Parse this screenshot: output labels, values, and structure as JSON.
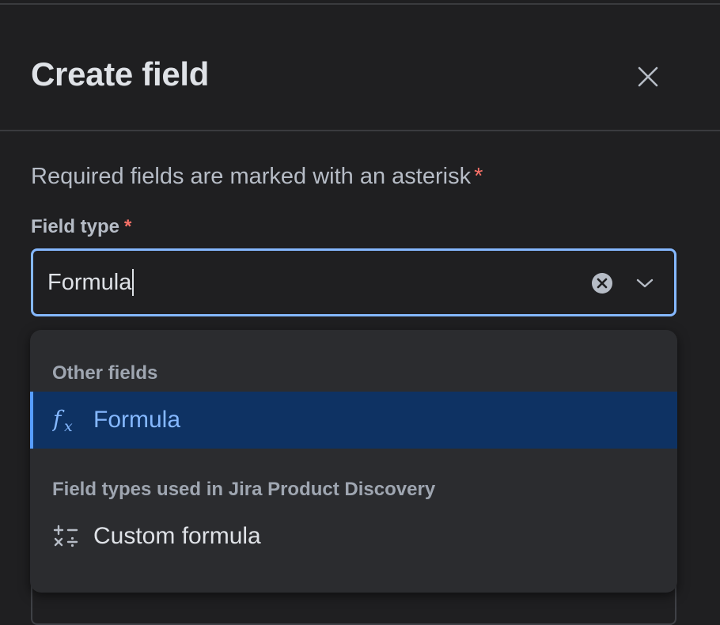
{
  "dialog": {
    "title": "Create field",
    "close_icon": "close-icon"
  },
  "form": {
    "required_note": "Required fields are marked with an asterisk",
    "required_marker": "*",
    "field_type": {
      "label": "Field type",
      "required_marker": "*",
      "value": "Formula",
      "clear_icon": "clear-circle-icon",
      "dropdown_icon": "chevron-down-icon"
    }
  },
  "dropdown": {
    "groups": [
      {
        "heading": "Other fields",
        "options": [
          {
            "label": "Formula",
            "icon": "formula-fx-icon",
            "selected": true
          }
        ]
      },
      {
        "heading": "Field types used in Jira Product Discovery",
        "options": [
          {
            "label": "Custom formula",
            "icon": "calculator-operators-icon",
            "selected": false
          }
        ]
      }
    ]
  },
  "colors": {
    "background": "#1f1f21",
    "focus_border": "#85b8ff",
    "selected_option_bg": "#0e3263",
    "selected_option_text": "#85b8ff",
    "required_asterisk": "#f87168"
  }
}
